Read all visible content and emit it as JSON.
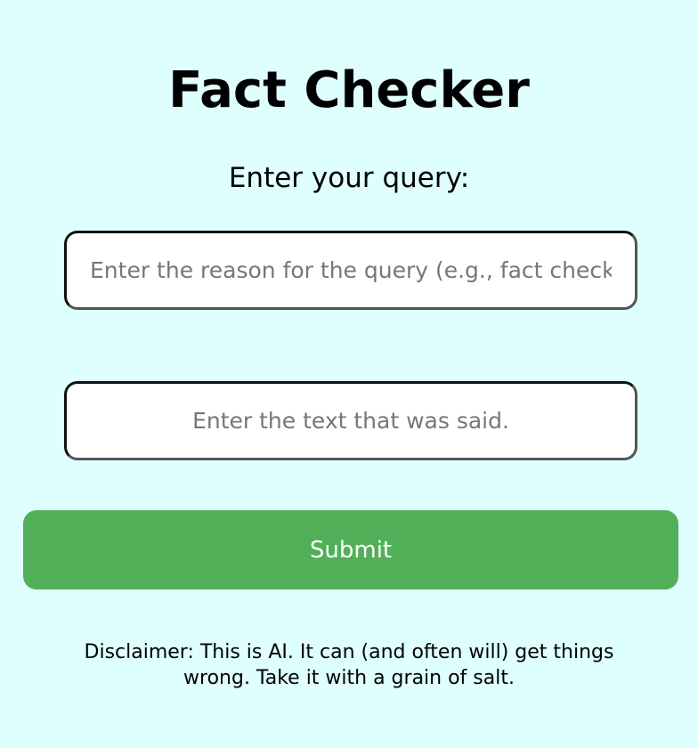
{
  "page": {
    "title": "Fact Checker",
    "subtitle": "Enter your query:"
  },
  "form": {
    "reason_placeholder": "Enter the reason for the query (e.g., fact check",
    "reason_value": "",
    "text_placeholder": "Enter the text that was said.",
    "text_value": "",
    "submit_label": "Submit"
  },
  "footer": {
    "disclaimer": "Disclaimer: This is AI. It can (and often will) get things wrong. Take it with a grain of salt."
  },
  "colors": {
    "background": "#dfffff",
    "submit_button": "#51b057",
    "submit_text": "#ffffff"
  }
}
